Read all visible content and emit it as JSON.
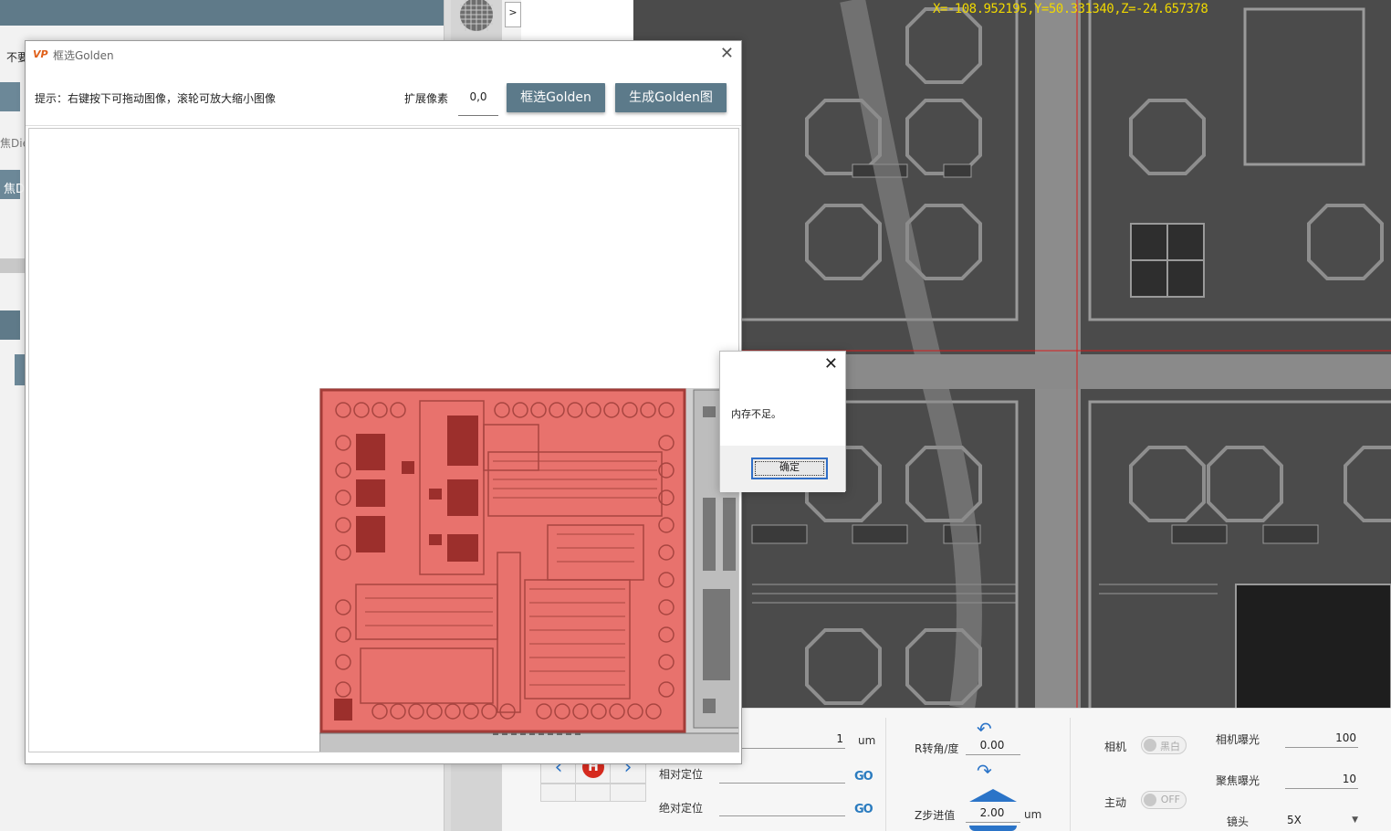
{
  "background": {
    "left_partial_texts": [
      "不要",
      "焦Die",
      "焦D"
    ],
    "collapse_button": ">"
  },
  "camera": {
    "coords": "X=-108.952195,Y=50.331340,Z=-24.657378"
  },
  "bottom_panel": {
    "step_value": "1",
    "step_unit": "um",
    "relative_label": "相对定位",
    "absolute_label": "绝对定位",
    "go_label": "GO",
    "home_label": "H",
    "r_label": "R转角/度",
    "r_value": "0.00",
    "z_label": "Z步进值",
    "z_value": "2.00",
    "z_unit": "um",
    "camera_label": "相机",
    "camera_toggle": "黑白",
    "active_label": "主动",
    "active_toggle": "OFF",
    "cam_exposure_label": "相机曝光",
    "cam_exposure_value": "100",
    "focus_exposure_label": "聚焦曝光",
    "focus_exposure_value": "10",
    "lens_label": "镜头",
    "lens_value": "5X"
  },
  "dialog": {
    "logo": "VP",
    "title": "框选Golden",
    "hint": "提示：右键按下可拖动图像，滚轮可放大缩小图像",
    "expand_label": "扩展像素",
    "expand_value": "0,0",
    "select_button": "框选Golden",
    "generate_button": "生成Golden图"
  },
  "message_box": {
    "text": "内存不足。",
    "ok": "确定"
  },
  "colors": {
    "accent": "#5c7a8a",
    "overlay_red": "#e8726d",
    "coords_yellow": "#f0d800",
    "crosshair": "#d81e1e"
  }
}
